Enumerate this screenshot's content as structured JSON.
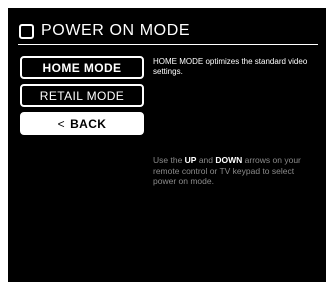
{
  "header": {
    "title": "POWER ON MODE",
    "icon": "square-outline-icon"
  },
  "menu": {
    "items": [
      {
        "label": "HOME MODE",
        "state": "selected"
      },
      {
        "label": "RETAIL MODE",
        "state": "normal"
      },
      {
        "label": "BACK",
        "state": "highlighted",
        "icon": "chevron-left-icon"
      }
    ],
    "back_arrow_glyph": "<"
  },
  "description": "HOME MODE optimizes the standard video settings.",
  "help": {
    "prefix": "Use the ",
    "up": "UP",
    "and": " and ",
    "down": "DOWN",
    "suffix": " arrows on your remote control or TV keypad to select power on mode."
  },
  "colors": {
    "background": "#000000",
    "foreground": "#ffffff",
    "help_text": "#8a8a8a",
    "frame": "#ffffff"
  }
}
